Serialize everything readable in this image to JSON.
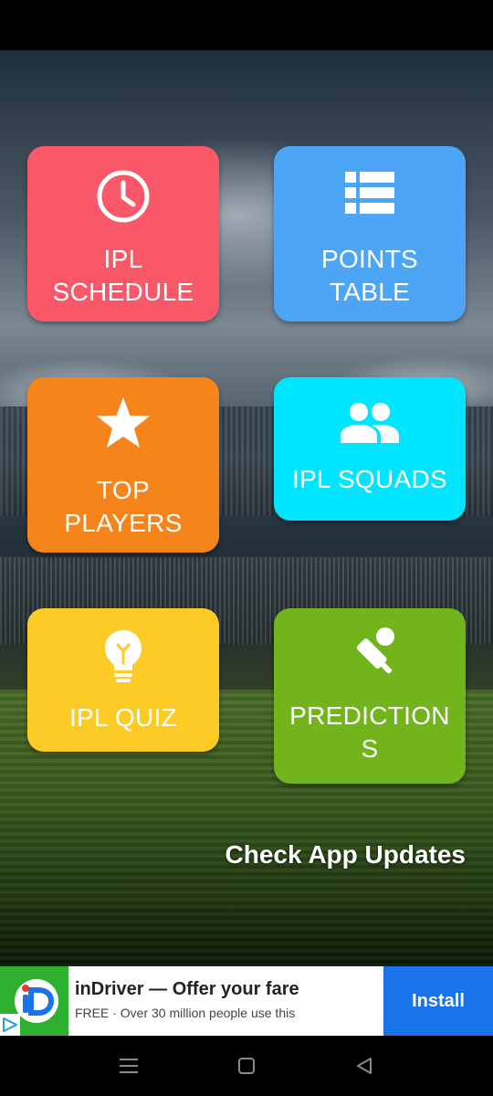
{
  "tiles": [
    {
      "id": "schedule",
      "label": "IPL SCHEDULE",
      "icon": "clock-icon",
      "color": "#f85868"
    },
    {
      "id": "points",
      "label": "POINTS TABLE",
      "icon": "list-table-icon",
      "color": "#4da6f5"
    },
    {
      "id": "players",
      "label": "TOP PLAYERS",
      "icon": "star-icon",
      "color": "#f5841a"
    },
    {
      "id": "squads",
      "label": "IPL SQUADS",
      "icon": "group-icon",
      "color": "#00e5ff"
    },
    {
      "id": "quiz",
      "label": "IPL QUIZ",
      "icon": "lightbulb-icon",
      "color": "#fccb26"
    },
    {
      "id": "predictions",
      "label": "PREDICTIONS",
      "icon": "cricket-bat-ball-icon",
      "color": "#72b41b"
    }
  ],
  "updates_label": "Check App Updates",
  "ad": {
    "title": "inDriver — Offer your fare",
    "subtitle": "FREE · Over 30 million people use this",
    "install_label": "Install",
    "brand_color": "#2eb12e",
    "install_color": "#1a73e8"
  },
  "nav": {
    "icons": [
      "menu-icon",
      "home-square-icon",
      "back-triangle-icon"
    ]
  }
}
